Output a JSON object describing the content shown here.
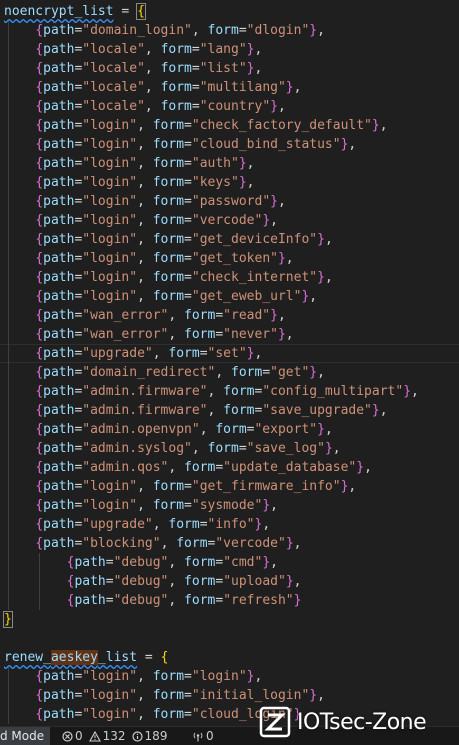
{
  "editor": {
    "lines": [
      {
        "kind": "decl",
        "ident": "noencrypt_list",
        "op": " = ",
        "brace": "{"
      },
      {
        "kind": "entry",
        "indent": 1,
        "path": "\"domain_login\"",
        "form": "\"dlogin\"",
        "tail": ","
      },
      {
        "kind": "entry",
        "indent": 1,
        "path": "\"locale\"",
        "form": "\"lang\"",
        "tail": ","
      },
      {
        "kind": "entry",
        "indent": 1,
        "path": "\"locale\"",
        "form": "\"list\"",
        "tail": ","
      },
      {
        "kind": "entry",
        "indent": 1,
        "path": "\"locale\"",
        "form": "\"multilang\"",
        "tail": ","
      },
      {
        "kind": "entry",
        "indent": 1,
        "path": "\"locale\"",
        "form": "\"country\"",
        "tail": ","
      },
      {
        "kind": "entry",
        "indent": 1,
        "path": "\"login\"",
        "form": "\"check_factory_default\"",
        "tail": ","
      },
      {
        "kind": "entry",
        "indent": 1,
        "path": "\"login\"",
        "form": "\"cloud_bind_status\"",
        "tail": ","
      },
      {
        "kind": "entry",
        "indent": 1,
        "path": "\"login\"",
        "form": "\"auth\"",
        "tail": ","
      },
      {
        "kind": "entry",
        "indent": 1,
        "path": "\"login\"",
        "form": "\"keys\"",
        "tail": ","
      },
      {
        "kind": "entry",
        "indent": 1,
        "path": "\"login\"",
        "form": "\"password\"",
        "tail": ","
      },
      {
        "kind": "entry",
        "indent": 1,
        "path": "\"login\"",
        "form": "\"vercode\"",
        "tail": ","
      },
      {
        "kind": "entry",
        "indent": 1,
        "path": "\"login\"",
        "form": "\"get_deviceInfo\"",
        "tail": ","
      },
      {
        "kind": "entry",
        "indent": 1,
        "path": "\"login\"",
        "form": "\"get_token\"",
        "tail": ","
      },
      {
        "kind": "entry",
        "indent": 1,
        "path": "\"login\"",
        "form": "\"check_internet\"",
        "tail": ","
      },
      {
        "kind": "entry",
        "indent": 1,
        "path": "\"login\"",
        "form": "\"get_eweb_url\"",
        "tail": ","
      },
      {
        "kind": "entry",
        "indent": 1,
        "path": "\"wan_error\"",
        "form": "\"read\"",
        "tail": ","
      },
      {
        "kind": "entry",
        "indent": 1,
        "path": "\"wan_error\"",
        "form": "\"never\"",
        "tail": ","
      },
      {
        "kind": "entry",
        "indent": 1,
        "path": "\"upgrade\"",
        "form": "\"set\"",
        "tail": ","
      },
      {
        "kind": "entry",
        "indent": 1,
        "path": "\"domain_redirect\"",
        "form": "\"get\"",
        "tail": ","
      },
      {
        "kind": "entry",
        "indent": 1,
        "path": "\"admin.firmware\"",
        "form": "\"config_multipart\"",
        "tail": ","
      },
      {
        "kind": "entry",
        "indent": 1,
        "path": "\"admin.firmware\"",
        "form": "\"save_upgrade\"",
        "tail": ","
      },
      {
        "kind": "entry",
        "indent": 1,
        "path": "\"admin.openvpn\"",
        "form": "\"export\"",
        "tail": ","
      },
      {
        "kind": "entry",
        "indent": 1,
        "path": "\"admin.syslog\"",
        "form": "\"save_log\"",
        "tail": ","
      },
      {
        "kind": "entry",
        "indent": 1,
        "path": "\"admin.qos\"",
        "form": "\"update_database\"",
        "tail": ","
      },
      {
        "kind": "entry",
        "indent": 1,
        "path": "\"login\"",
        "form": "\"get_firmware_info\"",
        "tail": ","
      },
      {
        "kind": "entry",
        "indent": 1,
        "path": "\"login\"",
        "form": "\"sysmode\"",
        "tail": ","
      },
      {
        "kind": "entry",
        "indent": 1,
        "path": "\"upgrade\"",
        "form": "\"info\"",
        "tail": ","
      },
      {
        "kind": "entry",
        "indent": 1,
        "path": "\"blocking\"",
        "form": "\"vercode\"",
        "tail": ","
      },
      {
        "kind": "entry",
        "indent": 2,
        "path": "\"debug\"",
        "form": "\"cmd\"",
        "tail": ","
      },
      {
        "kind": "entry",
        "indent": 2,
        "path": "\"debug\"",
        "form": "\"upload\"",
        "tail": ","
      },
      {
        "kind": "entry",
        "indent": 2,
        "path": "\"debug\"",
        "form": "\"refresh\"",
        "tail": ""
      },
      {
        "kind": "close",
        "text": "}"
      },
      {
        "kind": "blank"
      },
      {
        "kind": "decl2",
        "ident_a": "renew_",
        "ident_b": "aeskey",
        "ident_c": "_list",
        "op": " = ",
        "brace": "{"
      },
      {
        "kind": "entry",
        "indent": 1,
        "path": "\"login\"",
        "form": "\"login\"",
        "tail": ","
      },
      {
        "kind": "entry",
        "indent": 1,
        "path": "\"login\"",
        "form": "\"initial_login\"",
        "tail": ","
      },
      {
        "kind": "entry",
        "indent": 1,
        "path": "\"login\"",
        "form": "\"cloud_login\"",
        "tail": ","
      }
    ]
  },
  "status_bar": {
    "mode": "d Mode",
    "errors": "0",
    "warnings": "132",
    "infos": "189",
    "ports": "0"
  },
  "watermark": {
    "text": "IOTsec-Zone"
  },
  "colors": {
    "background": "#1f1f1f",
    "identifier": "#9cdcfe",
    "string": "#ce9178",
    "bracket_level1": "#ffd700",
    "bracket_level2": "#da70d6",
    "bracket_level3": "#179fff"
  }
}
